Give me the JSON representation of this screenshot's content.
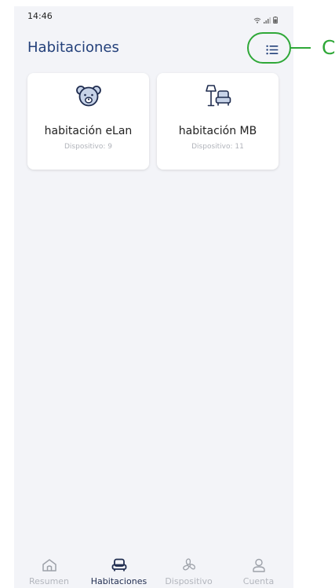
{
  "status_bar": {
    "time": "14:46",
    "icons": [
      "wifi-icon",
      "signal-icon",
      "battery-icon"
    ]
  },
  "header": {
    "title": "Habitaciones",
    "menu_icon": "list-icon"
  },
  "rooms": [
    {
      "icon": "bear-icon",
      "name": "habitación eLan",
      "subtitle": "Dispositivo: 9"
    },
    {
      "icon": "armchair-lamp-icon",
      "name": "habitación MB",
      "subtitle": "Dispositivo: 11"
    }
  ],
  "bottom_nav": [
    {
      "icon": "home-icon",
      "label": "Resumen",
      "active": false
    },
    {
      "icon": "armchair-icon",
      "label": "Habitaciones",
      "active": true
    },
    {
      "icon": "fan-icon",
      "label": "Dispositivo",
      "active": false
    },
    {
      "icon": "user-icon",
      "label": "Cuenta",
      "active": false
    }
  ],
  "annotation": {
    "letter": "C",
    "color": "#2fa838"
  },
  "colors": {
    "accent": "#23407a",
    "background": "#f3f4f8",
    "inactive": "#b3b6bd",
    "highlight": "#2fa838"
  }
}
